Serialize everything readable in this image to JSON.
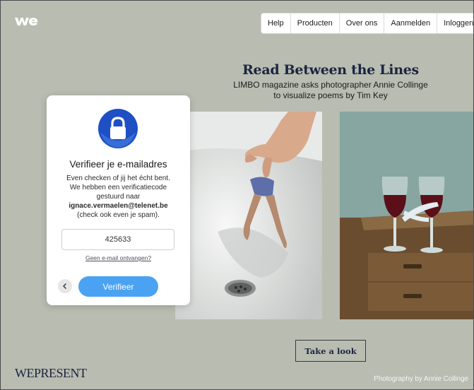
{
  "nav": {
    "items": [
      "Help",
      "Producten",
      "Over ons",
      "Aanmelden",
      "Inloggen"
    ]
  },
  "hero": {
    "title": "Read Between the Lines",
    "subtitle_line1": "LIMBO magazine asks photographer Annie Collinge",
    "subtitle_line2": "to visualize poems by Tim Key",
    "cta": "Take a look"
  },
  "modal": {
    "title": "Verifieer je e-mailadres",
    "desc_line1": "Even checken of jij het écht bent.",
    "desc_line2": "We hebben een verificatiecode",
    "desc_line3": "gestuurd naar",
    "email": "ignace.vermaelen@telenet.be",
    "desc_line4": "(check ook even je spam).",
    "code_value": "425633",
    "resend_link": "Geen e-mail ontvangen?",
    "verify_label": "Verifieer",
    "back_icon": "chevron-left-icon",
    "lock_icon": "lock-icon"
  },
  "footer": {
    "brand": "WEPRESENT",
    "credit": "Photography by Annie Collinge"
  },
  "colors": {
    "background": "#b9bcb1",
    "accent_blue": "#4aa3f2",
    "lock_badge": "#1f4fc4",
    "headline": "#1a2540"
  }
}
